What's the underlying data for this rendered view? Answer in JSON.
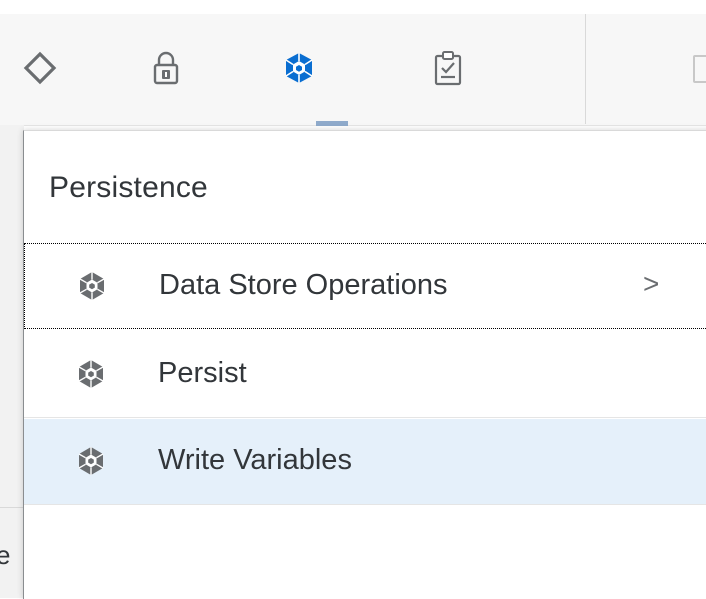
{
  "toolbar": {
    "icons": [
      {
        "name": "diamond-icon",
        "active": false
      },
      {
        "name": "lock-icon",
        "active": false
      },
      {
        "name": "persistence-cube-icon",
        "active": true
      },
      {
        "name": "clipboard-check-icon",
        "active": false
      }
    ],
    "active_color": "#0a6ed1",
    "inactive_color": "#6a6d70"
  },
  "underlying": {
    "left_text": "e"
  },
  "popover": {
    "title": "Persistence",
    "items": [
      {
        "label": "Data Store Operations",
        "has_submenu": true,
        "arrow": ">",
        "state": "focused"
      },
      {
        "label": "Persist",
        "has_submenu": false,
        "state": "normal"
      },
      {
        "label": "Write Variables",
        "has_submenu": false,
        "state": "selected"
      }
    ]
  },
  "colors": {
    "selected_bg": "#e5f0fa",
    "text": "#32363a",
    "icon_gray": "#6a6d70"
  }
}
